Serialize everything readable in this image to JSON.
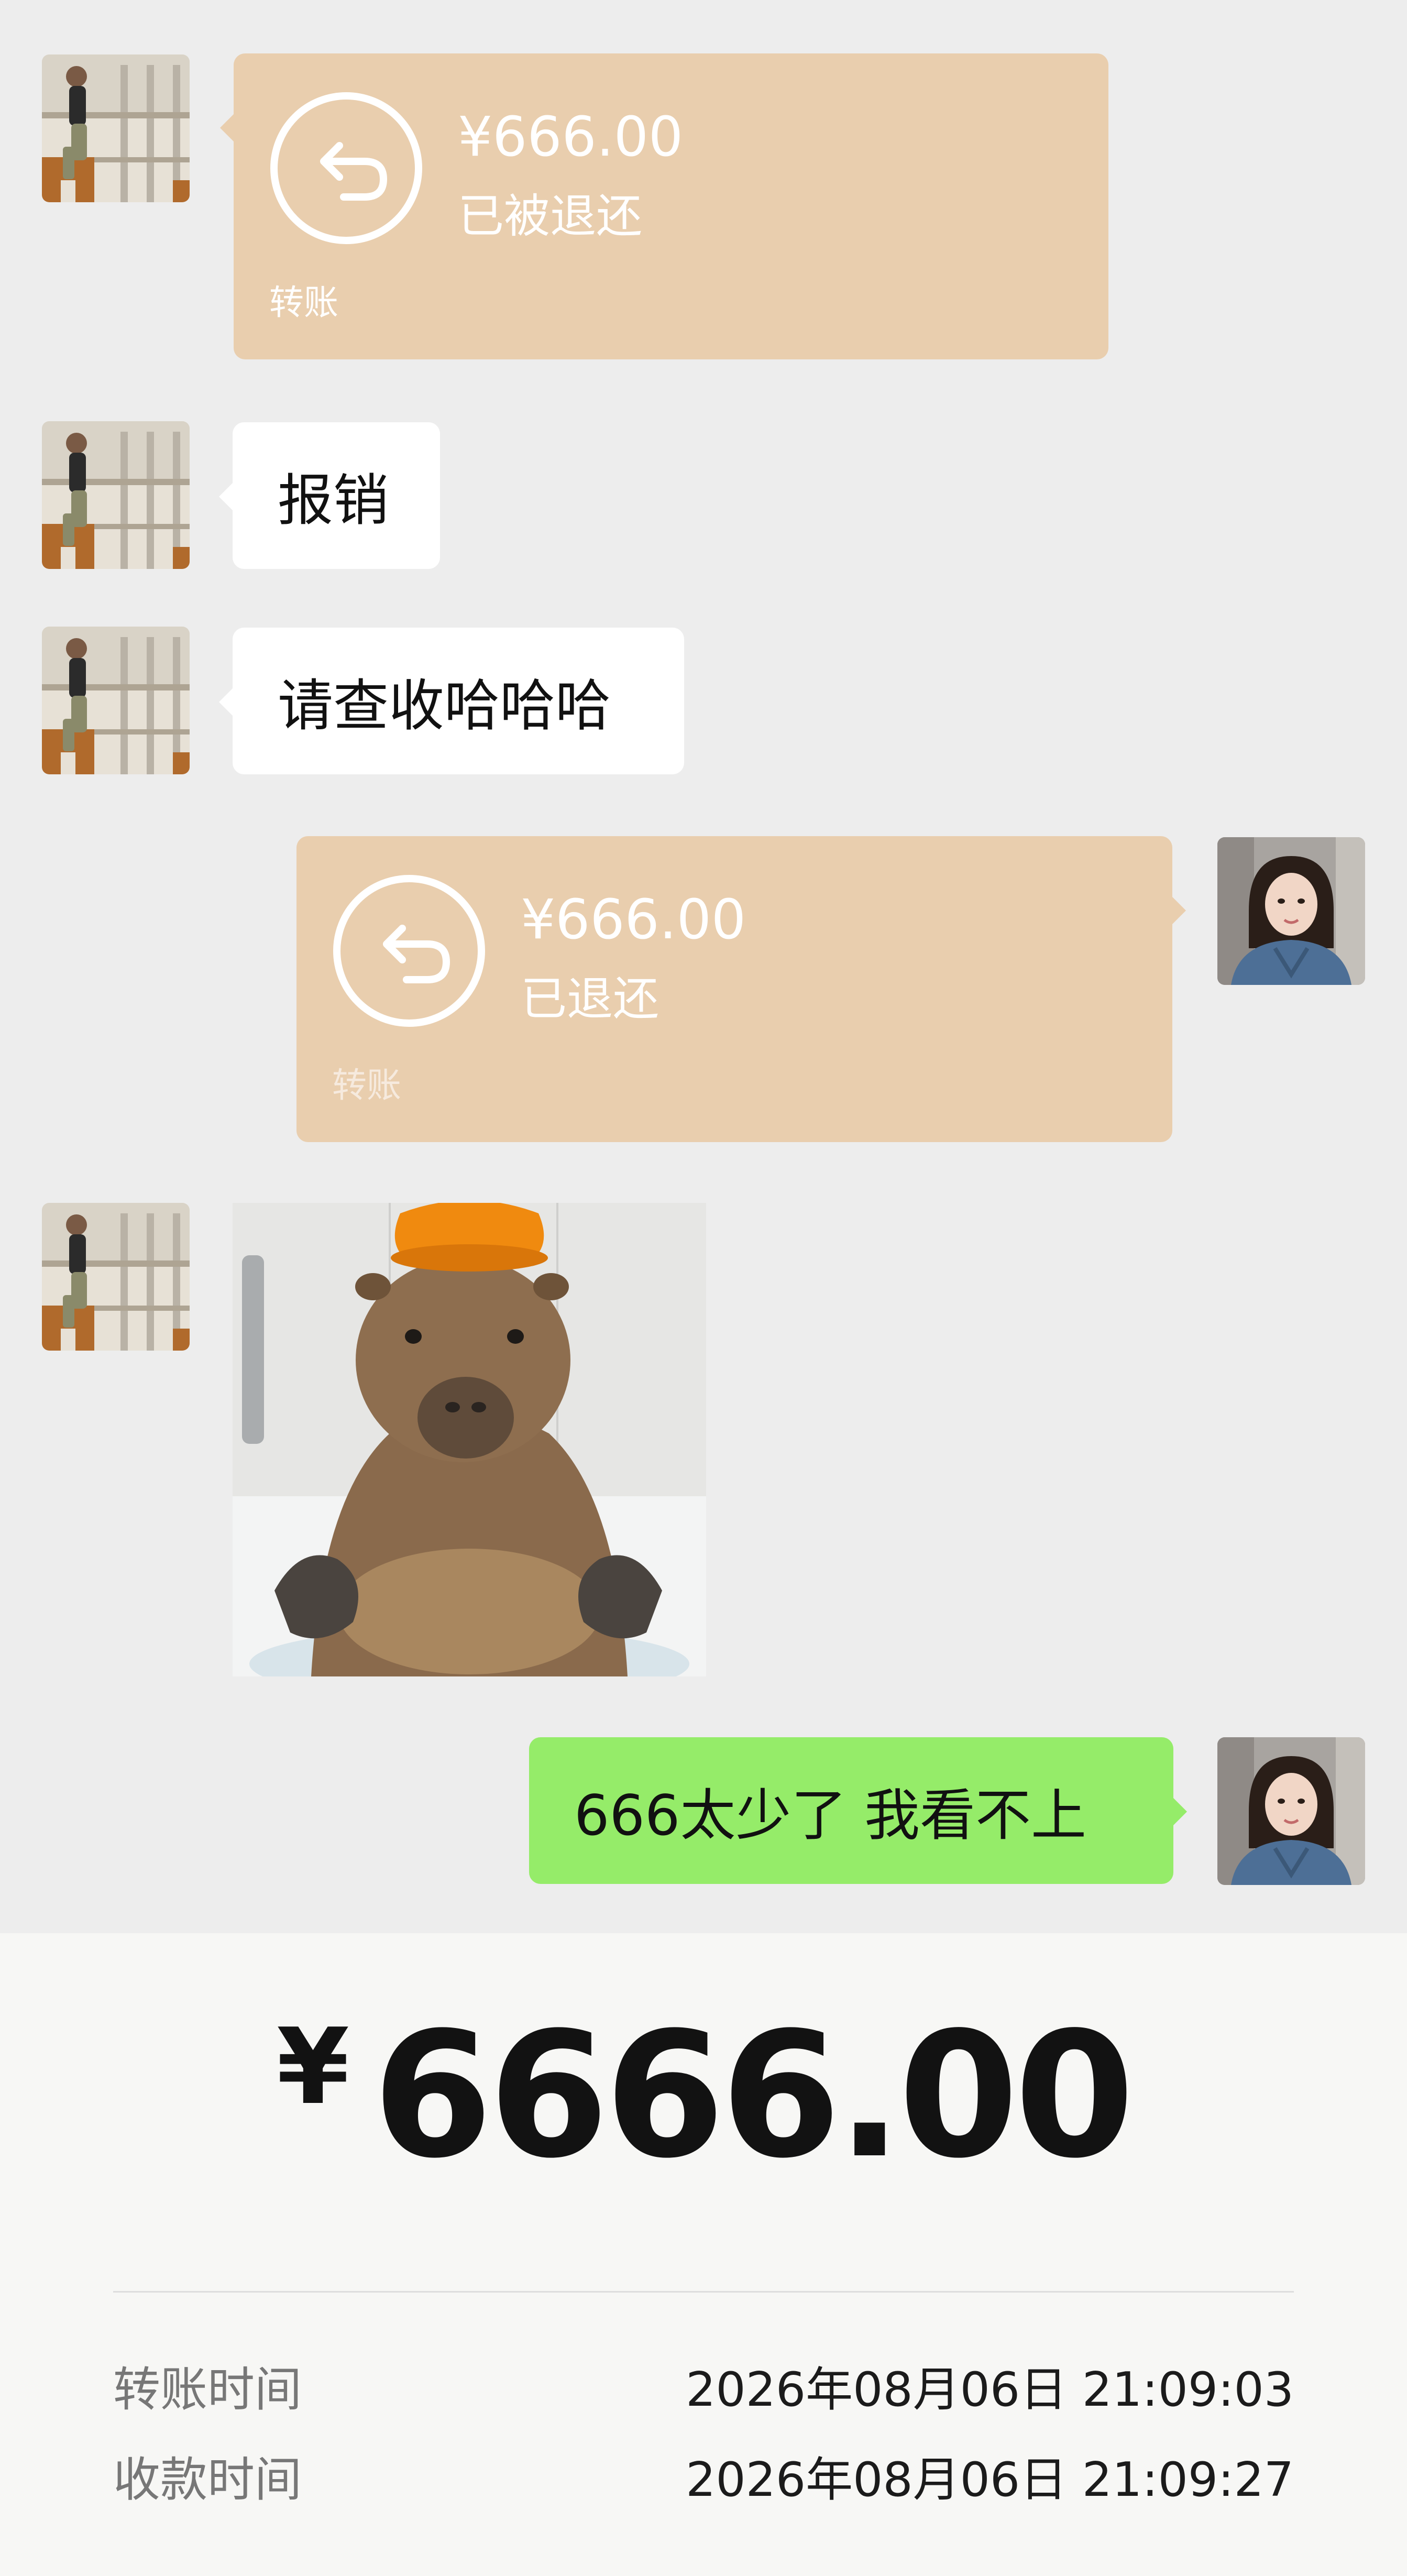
{
  "chat": {
    "messages": [
      {
        "type": "transfer",
        "side": "left",
        "amount": "¥666.00",
        "status": "已被退还",
        "label": "转账"
      },
      {
        "type": "text",
        "side": "left",
        "text": "报销"
      },
      {
        "type": "text",
        "side": "left",
        "text": "请查收哈哈哈"
      },
      {
        "type": "transfer",
        "side": "right",
        "amount": "¥666.00",
        "status": "已退还",
        "label": "转账"
      },
      {
        "type": "sticker",
        "side": "left",
        "icon": "capybara-sticker"
      },
      {
        "type": "text",
        "side": "right",
        "text": "666太少了 我看不上"
      }
    ]
  },
  "receipt": {
    "currency": "¥",
    "amount": "6666.00",
    "rows": [
      {
        "label": "转账时间",
        "value": "2026年08月06日 21:09:03"
      },
      {
        "label": "收款时间",
        "value": "2026年08月06日 21:09:27"
      }
    ]
  },
  "colors": {
    "chat_background": "#ededed",
    "transfer_bubble": "#e9ceae",
    "sent_bubble": "#95ec69",
    "received_bubble": "#ffffff"
  }
}
